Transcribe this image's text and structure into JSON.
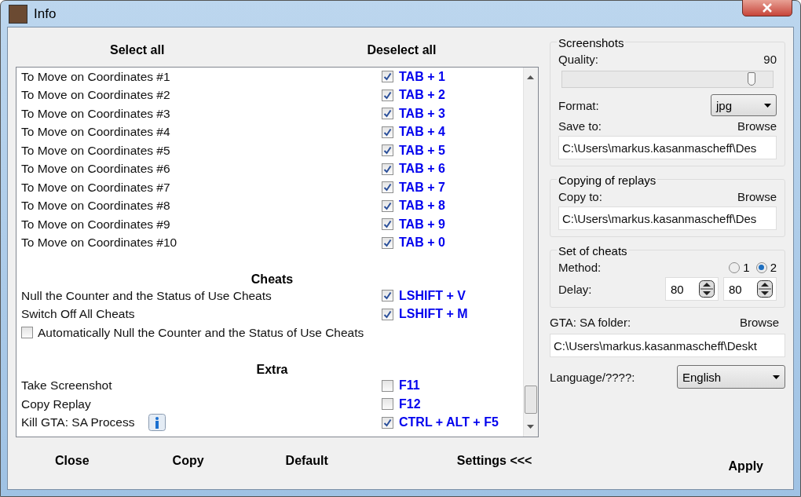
{
  "window": {
    "title": "Info"
  },
  "header_buttons": [
    "Select all",
    "Deselect all"
  ],
  "hotkey_list": {
    "sections": [
      {
        "items": [
          {
            "kind": "hotkey",
            "label": "To Move on Coordinates #1",
            "checked": true,
            "keys": "TAB + 1"
          },
          {
            "kind": "hotkey",
            "label": "To Move on Coordinates #2",
            "checked": true,
            "keys": "TAB + 2"
          },
          {
            "kind": "hotkey",
            "label": "To Move on Coordinates #3",
            "checked": true,
            "keys": "TAB + 3"
          },
          {
            "kind": "hotkey",
            "label": "To Move on Coordinates #4",
            "checked": true,
            "keys": "TAB + 4"
          },
          {
            "kind": "hotkey",
            "label": "To Move on Coordinates #5",
            "checked": true,
            "keys": "TAB + 5"
          },
          {
            "kind": "hotkey",
            "label": "To Move on Coordinates #6",
            "checked": true,
            "keys": "TAB + 6"
          },
          {
            "kind": "hotkey",
            "label": "To Move on Coordinates #7",
            "checked": true,
            "keys": "TAB + 7"
          },
          {
            "kind": "hotkey",
            "label": "To Move on Coordinates #8",
            "checked": true,
            "keys": "TAB + 8"
          },
          {
            "kind": "hotkey",
            "label": "To Move on Coordinates #9",
            "checked": true,
            "keys": "TAB + 9"
          },
          {
            "kind": "hotkey",
            "label": "To Move on Coordinates #10",
            "checked": true,
            "keys": "TAB + 0"
          }
        ]
      },
      {
        "heading": "Cheats",
        "items": [
          {
            "kind": "hotkey",
            "label": "Null the Counter and the Status of Use Cheats",
            "checked": true,
            "keys": "LSHIFT + V"
          },
          {
            "kind": "hotkey",
            "label": "Switch Off All Cheats",
            "checked": true,
            "keys": "LSHIFT + M"
          },
          {
            "kind": "option",
            "label": "Automatically Null the Counter and the Status of Use Cheats",
            "checked": false
          }
        ]
      },
      {
        "heading": "Extra",
        "items": [
          {
            "kind": "hotkey",
            "label": "Take Screenshot",
            "checked": false,
            "keys": "F11"
          },
          {
            "kind": "hotkey",
            "label": "Copy Replay",
            "checked": false,
            "keys": "F12"
          },
          {
            "kind": "hotkey",
            "label": "Kill GTA: SA Process",
            "checked": true,
            "keys": "CTRL + ALT + F5",
            "info": true
          }
        ]
      }
    ]
  },
  "footer_buttons": [
    "Close",
    "Copy",
    "Default",
    "Settings <<<"
  ],
  "settings": {
    "screenshots": {
      "title": "Screenshots",
      "quality_label": "Quality:",
      "quality_value": "90",
      "level": 0.9,
      "format_label": "Format:",
      "format": "jpg",
      "save_to_label": "Save to:",
      "browse": "Browse",
      "path": "C:\\Users\\markus.kasanmascheff\\Des"
    },
    "replays": {
      "title": "Copying of replays",
      "copy_to_label": "Copy to:",
      "browse": "Browse",
      "path": "C:\\Users\\markus.kasanmascheff\\Des"
    },
    "cheats": {
      "title": "Set of cheats",
      "method_label": "Method:",
      "methods": [
        {
          "label": "1",
          "selected": false
        },
        {
          "label": "2",
          "selected": true
        }
      ],
      "delay_label": "Delay:",
      "delays": [
        "80",
        "80"
      ]
    },
    "gta_folder": {
      "label": "GTA: SA folder:",
      "browse": "Browse",
      "path": "C:\\Users\\markus.kasanmascheff\\Deskt"
    },
    "language": {
      "label": "Language/????:",
      "value": "English"
    },
    "apply": "Apply"
  }
}
